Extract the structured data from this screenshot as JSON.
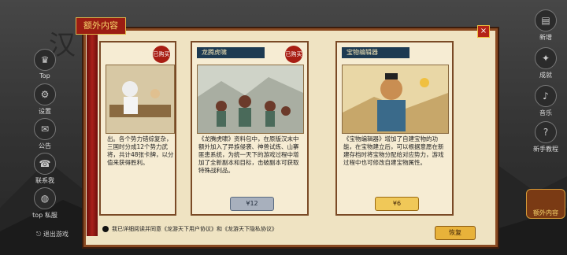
{
  "background": {
    "left_glyph": "汉",
    "left_buttons": [
      {
        "label": "Top",
        "icon": "trophy-icon"
      },
      {
        "label": "设置",
        "icon": "gear-icon"
      },
      {
        "label": "公告",
        "icon": "notice-icon"
      },
      {
        "label": "联系我",
        "icon": "chat-icon"
      },
      {
        "label": "top 私服",
        "icon": "globe-icon"
      }
    ],
    "exit_label": "退出游戏",
    "right_buttons": [
      {
        "label": "新增",
        "icon": "book-icon"
      },
      {
        "label": "成就",
        "icon": "medal-icon"
      },
      {
        "label": "音乐",
        "icon": "note-icon"
      },
      {
        "label": "新手教程",
        "icon": "guide-icon"
      }
    ],
    "right_badge": "额外内容"
  },
  "panel": {
    "title": "额外内容",
    "close_symbol": "×"
  },
  "cards": [
    {
      "title": "",
      "purchased": "已购买",
      "desc": "出。各个势力错综复杂，三国时分成12个势力武将，共计48张卡牌，以分值来获得胜利。",
      "price": ""
    },
    {
      "title": "龙腾虎啸",
      "purchased": "已购买",
      "desc": "《龙腾虎啸》资料包中，在原版汉末中额外加入了异族侵袭、神兽试炼、山寨匪患系统，为统一天下的游戏过程中增加了全新副本和目标，击破副本可获取特殊战利品。",
      "price": "¥12"
    },
    {
      "title": "宝物编辑器",
      "purchased": "",
      "desc": "《宝物编辑器》增加了自建宝物的功能，在宝物建立后，可以根据意愿在新建存档时将宝物分配给对应势力，游戏过程中也可修改自建宝物属性。",
      "price": "¥6"
    }
  ],
  "footer": {
    "agree_text": "我已详细阅读并同意《龙游天下用户协议》和《龙游天下隐私协议》"
  },
  "restore_button": "恢复"
}
